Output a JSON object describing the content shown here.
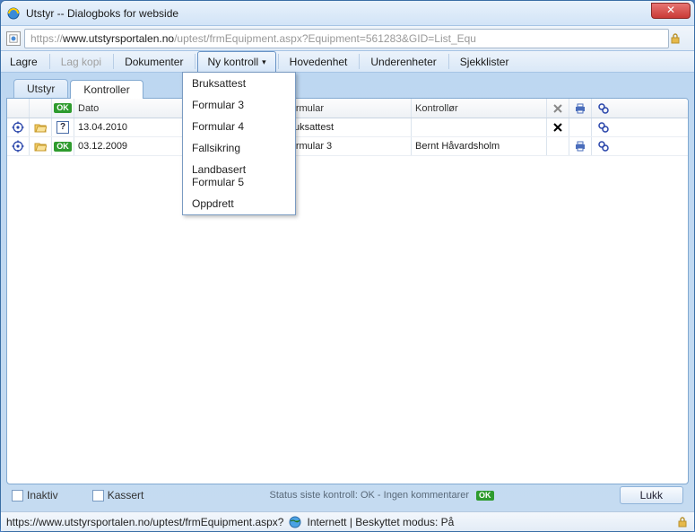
{
  "window": {
    "title": "Utstyr -- Dialogboks for webside"
  },
  "address": {
    "protocol": "https://",
    "host": "www.utstyrsportalen.no",
    "path": "/uptest/frmEquipment.aspx?Equipment=561283&GID=List_Equ"
  },
  "menubar": {
    "lagre": "Lagre",
    "lagkopi": "Lag kopi",
    "dokumenter": "Dokumenter",
    "nykontroll": "Ny kontroll",
    "hovedenhet": "Hovedenhet",
    "underenheter": "Underenheter",
    "sjekklister": "Sjekklister"
  },
  "dropdown": {
    "items": [
      "Bruksattest",
      "Formular 3",
      "Formular 4",
      "Fallsikring",
      "Landbasert Formular 5",
      "Oppdrett"
    ]
  },
  "tabs": {
    "utstyr": "Utstyr",
    "kontroller": "Kontroller"
  },
  "header": {
    "ok": "OK",
    "dato": "Dato",
    "formular": "Formular",
    "kontrollor": "Kontrollør"
  },
  "rows": [
    {
      "status": "?",
      "dato": "13.04.2010",
      "formular": "Bruksattest",
      "kontrollor": "",
      "x": true,
      "print": false,
      "chain": true
    },
    {
      "status": "ok",
      "dato": "03.12.2009",
      "formular": "Formular 3",
      "kontrollor": "Bernt Håvardsholm",
      "x": false,
      "print": true,
      "chain": true
    }
  ],
  "footer": {
    "inaktiv": "Inaktiv",
    "kassert": "Kassert",
    "status": "Status siste kontroll: OK - Ingen kommentarer",
    "lukk": "Lukk"
  },
  "statusbar": {
    "url": "https://www.utstyrsportalen.no/uptest/frmEquipment.aspx?",
    "zone": "Internett | Beskyttet modus: På"
  }
}
